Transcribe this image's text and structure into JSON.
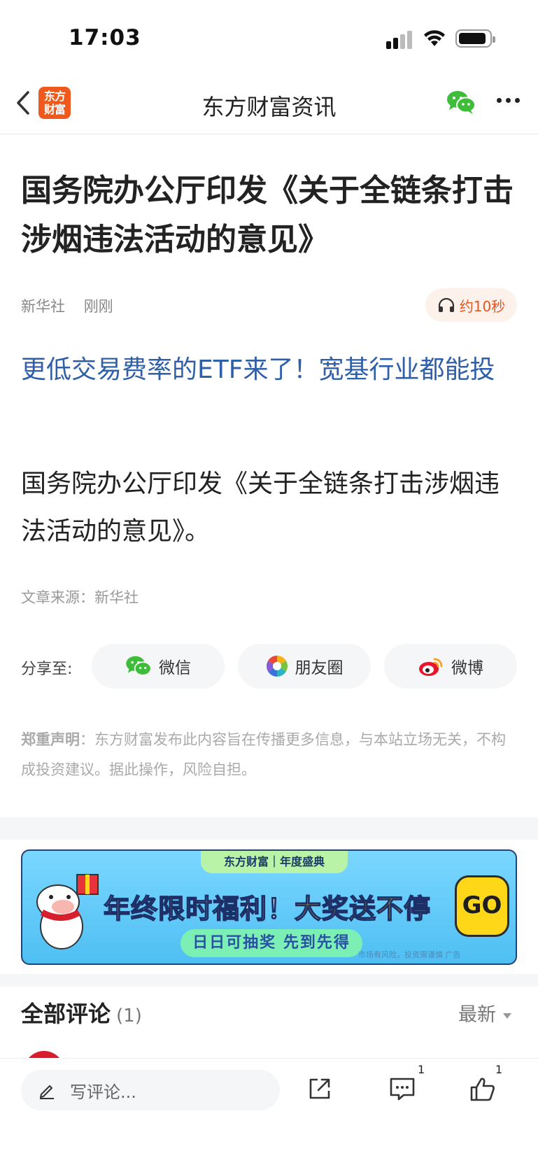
{
  "status_bar": {
    "time": "17:03"
  },
  "nav": {
    "back_icon": "chevron-left-icon",
    "logo_text_line1": "东方",
    "logo_text_line2": "财富",
    "title": "东方财富资讯",
    "share_icon": "wechat-icon",
    "more_icon": "more-dots-icon"
  },
  "article": {
    "headline": "国务院办公厅印发《关于全链条打击涉烟违法活动的意见》",
    "source_name": "新华社",
    "time": "刚刚",
    "listen_label": "约10秒",
    "promo_link": "更低交易费率的ETF来了！宽基行业都能投",
    "body": "国务院办公厅印发《关于全链条打击涉烟违法活动的意见》。",
    "article_source": "文章来源：新华社"
  },
  "share": {
    "label": "分享至:",
    "buttons": [
      {
        "label": "微信",
        "icon": "wechat-icon"
      },
      {
        "label": "朋友圈",
        "icon": "moments-icon"
      },
      {
        "label": "微博",
        "icon": "weibo-icon"
      }
    ]
  },
  "disclaimer": {
    "title": "郑重声明",
    "text": "：东方财富发布此内容旨在传播更多信息，与本站立场无关，不构成投资建议。据此操作，风险自担。"
  },
  "banner": {
    "tag": "东方财富｜年度盛典",
    "title_white": "年终限时福利！",
    "title_yellow": "大奖送不停",
    "subtitle": "日日可抽奖 先到先得",
    "risk": "市场有风险，投资需谨慎 广告",
    "go": "GO"
  },
  "comments": {
    "title": "全部评论",
    "count": "(1)",
    "sort": "最新"
  },
  "bottom_bar": {
    "input_placeholder": "写评论...",
    "comment_badge": "1",
    "like_badge": "1"
  },
  "colors": {
    "brand_orange": "#ef5a1c",
    "link_blue": "#2f5fa8",
    "wechat_green": "#3fbc3a"
  }
}
